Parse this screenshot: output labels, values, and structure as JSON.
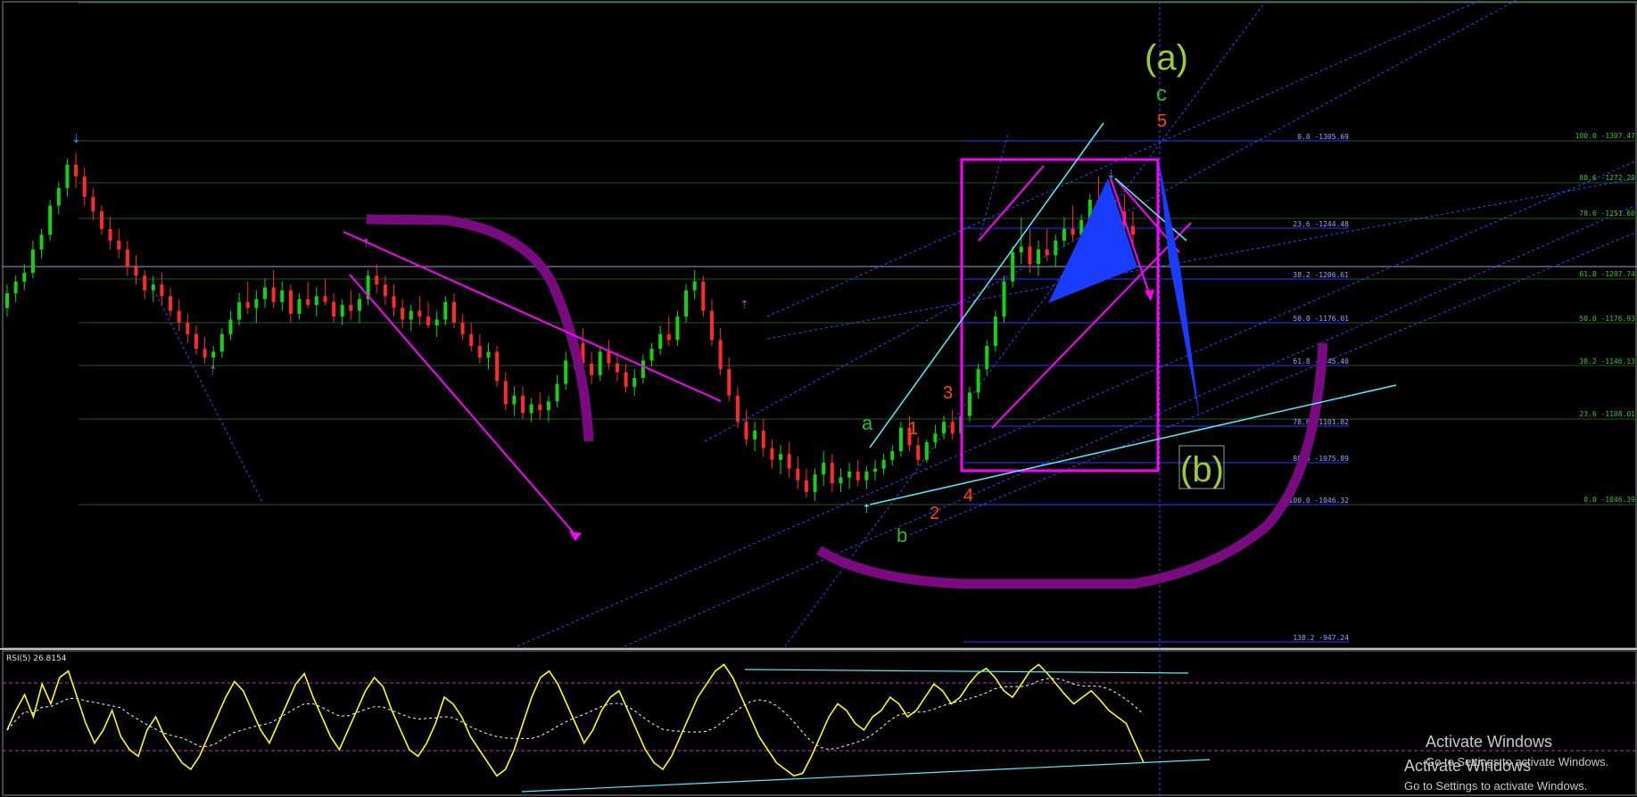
{
  "chart_data": {
    "type": "candlestick",
    "colors": {
      "up": "#13d313",
      "down": "#ff2a2a",
      "pink": "#ff00ff",
      "purple": "#7a0a80",
      "cyan": "#4ff0ff",
      "blue": "#1a3cff",
      "gridGreen": "#1e5a1e",
      "fibBlue": "#2a3cff",
      "rsi": "#ffff00"
    },
    "candles": [
      [
        1.25,
        1.33,
        1.22,
        1.3
      ],
      [
        1.3,
        1.36,
        1.27,
        1.34
      ],
      [
        1.34,
        1.4,
        1.31,
        1.37
      ],
      [
        1.37,
        1.48,
        1.35,
        1.45
      ],
      [
        1.45,
        1.52,
        1.42,
        1.5
      ],
      [
        1.5,
        1.62,
        1.48,
        1.6
      ],
      [
        1.6,
        1.68,
        1.57,
        1.66
      ],
      [
        1.66,
        1.76,
        1.63,
        1.74
      ],
      [
        1.74,
        1.78,
        1.66,
        1.7
      ],
      [
        1.7,
        1.73,
        1.6,
        1.63
      ],
      [
        1.63,
        1.66,
        1.55,
        1.58
      ],
      [
        1.58,
        1.6,
        1.5,
        1.52
      ],
      [
        1.52,
        1.56,
        1.45,
        1.48
      ],
      [
        1.48,
        1.52,
        1.42,
        1.45
      ],
      [
        1.45,
        1.48,
        1.36,
        1.39
      ],
      [
        1.39,
        1.43,
        1.33,
        1.36
      ],
      [
        1.36,
        1.38,
        1.28,
        1.31
      ],
      [
        1.31,
        1.36,
        1.27,
        1.33
      ],
      [
        1.33,
        1.37,
        1.26,
        1.29
      ],
      [
        1.29,
        1.32,
        1.22,
        1.24
      ],
      [
        1.24,
        1.28,
        1.17,
        1.2
      ],
      [
        1.2,
        1.23,
        1.13,
        1.16
      ],
      [
        1.16,
        1.19,
        1.09,
        1.11
      ],
      [
        1.11,
        1.15,
        1.06,
        1.08
      ],
      [
        1.08,
        1.12,
        1.04,
        1.1
      ],
      [
        1.1,
        1.18,
        1.08,
        1.16
      ],
      [
        1.16,
        1.24,
        1.14,
        1.21
      ],
      [
        1.21,
        1.3,
        1.19,
        1.27
      ],
      [
        1.27,
        1.34,
        1.23,
        1.25
      ],
      [
        1.25,
        1.31,
        1.2,
        1.28
      ],
      [
        1.28,
        1.35,
        1.25,
        1.32
      ],
      [
        1.32,
        1.38,
        1.25,
        1.27
      ],
      [
        1.27,
        1.34,
        1.24,
        1.31
      ],
      [
        1.31,
        1.33,
        1.2,
        1.23
      ],
      [
        1.23,
        1.3,
        1.21,
        1.28
      ],
      [
        1.28,
        1.34,
        1.25,
        1.26
      ],
      [
        1.26,
        1.32,
        1.22,
        1.29
      ],
      [
        1.29,
        1.35,
        1.26,
        1.27
      ],
      [
        1.27,
        1.3,
        1.2,
        1.22
      ],
      [
        1.22,
        1.28,
        1.19,
        1.26
      ],
      [
        1.26,
        1.31,
        1.21,
        1.24
      ],
      [
        1.24,
        1.3,
        1.2,
        1.28
      ],
      [
        1.28,
        1.38,
        1.26,
        1.36
      ],
      [
        1.36,
        1.4,
        1.3,
        1.33
      ],
      [
        1.33,
        1.36,
        1.26,
        1.29
      ],
      [
        1.29,
        1.33,
        1.22,
        1.25
      ],
      [
        1.25,
        1.28,
        1.18,
        1.21
      ],
      [
        1.21,
        1.26,
        1.17,
        1.24
      ],
      [
        1.24,
        1.29,
        1.19,
        1.22
      ],
      [
        1.22,
        1.27,
        1.18,
        1.19
      ],
      [
        1.19,
        1.24,
        1.15,
        1.21
      ],
      [
        1.21,
        1.29,
        1.19,
        1.27
      ],
      [
        1.27,
        1.3,
        1.18,
        1.2
      ],
      [
        1.2,
        1.23,
        1.14,
        1.16
      ],
      [
        1.16,
        1.2,
        1.1,
        1.12
      ],
      [
        1.12,
        1.16,
        1.06,
        1.08
      ],
      [
        1.08,
        1.13,
        1.04,
        1.1
      ],
      [
        1.1,
        1.12,
        0.98,
        1.0
      ],
      [
        1.0,
        1.03,
        0.9,
        0.92
      ],
      [
        0.92,
        0.98,
        0.88,
        0.95
      ],
      [
        0.95,
        0.98,
        0.87,
        0.89
      ],
      [
        0.89,
        0.94,
        0.86,
        0.92
      ],
      [
        0.92,
        0.96,
        0.87,
        0.9
      ],
      [
        0.9,
        0.95,
        0.86,
        0.93
      ],
      [
        0.93,
        1.02,
        0.91,
        0.99
      ],
      [
        0.99,
        1.1,
        0.97,
        1.07
      ],
      [
        1.07,
        1.16,
        1.04,
        1.13
      ],
      [
        1.13,
        1.18,
        1.04,
        1.06
      ],
      [
        1.06,
        1.1,
        0.99,
        1.02
      ],
      [
        1.02,
        1.12,
        1.0,
        1.1
      ],
      [
        1.1,
        1.14,
        1.04,
        1.06
      ],
      [
        1.06,
        1.1,
        1.0,
        1.03
      ],
      [
        1.03,
        1.06,
        0.96,
        0.98
      ],
      [
        0.98,
        1.04,
        0.95,
        1.01
      ],
      [
        1.01,
        1.09,
        0.99,
        1.07
      ],
      [
        1.07,
        1.13,
        1.05,
        1.11
      ],
      [
        1.11,
        1.19,
        1.09,
        1.16
      ],
      [
        1.16,
        1.22,
        1.12,
        1.14
      ],
      [
        1.14,
        1.24,
        1.12,
        1.22
      ],
      [
        1.22,
        1.33,
        1.2,
        1.31
      ],
      [
        1.31,
        1.38,
        1.28,
        1.34
      ],
      [
        1.34,
        1.36,
        1.22,
        1.24
      ],
      [
        1.24,
        1.28,
        1.12,
        1.14
      ],
      [
        1.14,
        1.18,
        1.02,
        1.04
      ],
      [
        1.04,
        1.08,
        0.93,
        0.95
      ],
      [
        0.95,
        0.98,
        0.84,
        0.86
      ],
      [
        0.86,
        0.9,
        0.78,
        0.8
      ],
      [
        0.8,
        0.86,
        0.76,
        0.83
      ],
      [
        0.83,
        0.87,
        0.74,
        0.77
      ],
      [
        0.77,
        0.8,
        0.7,
        0.73
      ],
      [
        0.73,
        0.78,
        0.68,
        0.75
      ],
      [
        0.75,
        0.79,
        0.67,
        0.7
      ],
      [
        0.7,
        0.74,
        0.63,
        0.66
      ],
      [
        0.66,
        0.7,
        0.6,
        0.62
      ],
      [
        0.62,
        0.7,
        0.59,
        0.68
      ],
      [
        0.68,
        0.76,
        0.64,
        0.72
      ],
      [
        0.72,
        0.75,
        0.62,
        0.65
      ],
      [
        0.65,
        0.7,
        0.62,
        0.67
      ],
      [
        0.67,
        0.72,
        0.63,
        0.69
      ],
      [
        0.69,
        0.73,
        0.64,
        0.66
      ],
      [
        0.66,
        0.71,
        0.63,
        0.69
      ],
      [
        0.69,
        0.73,
        0.66,
        0.7
      ],
      [
        0.7,
        0.75,
        0.68,
        0.73
      ],
      [
        0.73,
        0.78,
        0.71,
        0.76
      ],
      [
        0.76,
        0.86,
        0.74,
        0.84
      ],
      [
        0.84,
        0.88,
        0.76,
        0.78
      ],
      [
        0.78,
        0.81,
        0.71,
        0.73
      ],
      [
        0.73,
        0.8,
        0.72,
        0.79
      ],
      [
        0.79,
        0.85,
        0.77,
        0.82
      ],
      [
        0.82,
        0.88,
        0.8,
        0.86
      ],
      [
        0.86,
        0.9,
        0.8,
        0.82
      ],
      [
        0.82,
        0.9,
        0.81,
        0.88
      ],
      [
        0.88,
        0.98,
        0.86,
        0.96
      ],
      [
        0.96,
        1.06,
        0.94,
        1.04
      ],
      [
        1.04,
        1.14,
        1.02,
        1.12
      ],
      [
        1.12,
        1.24,
        1.1,
        1.22
      ],
      [
        1.22,
        1.36,
        1.2,
        1.34
      ],
      [
        1.34,
        1.46,
        1.32,
        1.44
      ],
      [
        1.44,
        1.56,
        1.4,
        1.46
      ],
      [
        1.46,
        1.52,
        1.37,
        1.4
      ],
      [
        1.4,
        1.48,
        1.36,
        1.45
      ],
      [
        1.45,
        1.52,
        1.41,
        1.43
      ],
      [
        1.43,
        1.5,
        1.39,
        1.48
      ],
      [
        1.48,
        1.56,
        1.46,
        1.52
      ],
      [
        1.52,
        1.6,
        1.48,
        1.5
      ],
      [
        1.5,
        1.57,
        1.46,
        1.55
      ],
      [
        1.55,
        1.64,
        1.53,
        1.62
      ],
      [
        1.62,
        1.7,
        1.58,
        1.6
      ],
      [
        1.6,
        1.66,
        1.52,
        1.55
      ],
      [
        1.55,
        1.62,
        1.5,
        1.58
      ],
      [
        1.58,
        1.64,
        1.5,
        1.53
      ],
      [
        1.53,
        1.58,
        1.46,
        1.5
      ]
    ],
    "fib_levels_left": [
      "0.0 -1305.69",
      "23.6 -1244.48",
      "38.2 -1206.61",
      "50.0 -1176.01",
      "61.8 -1145.40",
      "78.6 -1101.82",
      "88.6 -1075.89",
      "100.0 -1046.32",
      "138.2 -947.24"
    ],
    "fib_levels_right": [
      "100.0 -1307.47",
      "88.6 -1272.29",
      "78.6 -1251.60",
      "61.8 -1207.74",
      "50.0 -1176.93",
      "38.2 -1146.13",
      "23.6 -1108.01",
      "0.0 -1046.39"
    ],
    "wave_labels": {
      "a_big": "(a)",
      "b_big": "(b)",
      "c": "c",
      "five": "5",
      "three": "3",
      "one": "1",
      "two": "2",
      "four": "4",
      "a": "a",
      "b": "b"
    },
    "rsi": {
      "label": "RSI(5) 26.8154",
      "values": [
        45,
        60,
        72,
        55,
        80,
        65,
        85,
        90,
        70,
        50,
        35,
        45,
        60,
        40,
        30,
        25,
        45,
        55,
        40,
        30,
        20,
        15,
        25,
        40,
        55,
        70,
        82,
        75,
        60,
        45,
        35,
        50,
        65,
        80,
        88,
        70,
        55,
        40,
        30,
        45,
        60,
        75,
        85,
        78,
        60,
        45,
        30,
        25,
        35,
        50,
        70,
        65,
        55,
        40,
        30,
        20,
        10,
        15,
        30,
        50,
        70,
        85,
        90,
        80,
        65,
        50,
        35,
        45,
        60,
        70,
        75,
        60,
        45,
        30,
        20,
        15,
        25,
        40,
        55,
        70,
        80,
        90,
        95,
        85,
        70,
        55,
        40,
        30,
        20,
        15,
        10,
        12,
        25,
        40,
        55,
        65,
        60,
        50,
        45,
        55,
        60,
        70,
        65,
        55,
        60,
        70,
        80,
        75,
        65,
        70,
        80,
        88,
        92,
        85,
        75,
        70,
        80,
        90,
        95,
        88,
        80,
        72,
        65,
        70,
        75,
        68,
        60,
        55,
        50,
        35,
        20
      ],
      "overbought": 80,
      "oversold": 20
    }
  },
  "watermark": {
    "title": "Activate Windows",
    "subtitle": "Go to Settings to activate Windows."
  }
}
